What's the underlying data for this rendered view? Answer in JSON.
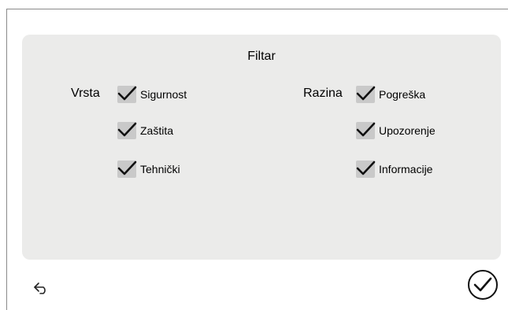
{
  "dialog": {
    "title": "Filtar"
  },
  "filters": {
    "vrsta": {
      "label": "Vrsta",
      "options": [
        {
          "label": "Sigurnost",
          "checked": true
        },
        {
          "label": "Zaštita",
          "checked": true
        },
        {
          "label": "Tehnički",
          "checked": true
        }
      ]
    },
    "razina": {
      "label": "Razina",
      "options": [
        {
          "label": "Pogreška",
          "checked": true
        },
        {
          "label": "Upozorenje",
          "checked": true
        },
        {
          "label": "Informacije",
          "checked": true
        }
      ]
    }
  },
  "footer": {
    "back_icon": "back-arrow-icon",
    "confirm_icon": "checkmark-icon"
  }
}
